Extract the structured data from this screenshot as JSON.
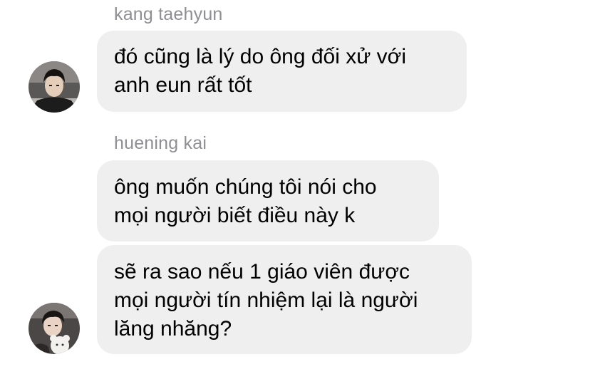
{
  "messages": [
    {
      "sender": "kang taehyun",
      "bubbles": [
        "đó cũng là lý do ông đối xử với\nanh eun rất tốt"
      ]
    },
    {
      "sender": "huening kai",
      "bubbles": [
        "ông muốn chúng tôi nói cho\nmọi người biết điều này k",
        "sẽ ra sao nếu 1 giáo viên được\nmọi người tín nhiệm lại là người\nlăng nhăng?"
      ]
    }
  ],
  "colors": {
    "bubble": "#efeff0",
    "sender_name": "#8e8e93",
    "text": "#000000",
    "background": "#ffffff"
  }
}
